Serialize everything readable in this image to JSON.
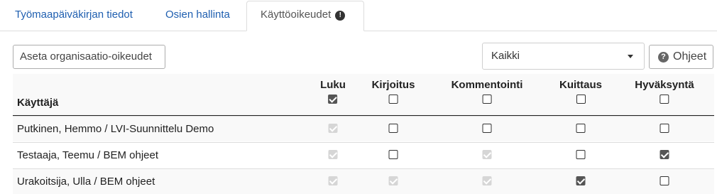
{
  "tabs": [
    {
      "label": "Työmaapäiväkirjan tiedot",
      "active": false
    },
    {
      "label": "Osien hallinta",
      "active": false
    },
    {
      "label": "Käyttöoikeudet",
      "active": true,
      "icon": "exclamation-circle-icon"
    }
  ],
  "toolbar": {
    "org_button_label": "Aseta organisaatio-oikeudet",
    "filter_value": "Kaikki",
    "help_button_label": "Ohjeet",
    "help_icon": "question-circle-icon"
  },
  "table": {
    "user_header": "Käyttäjä",
    "columns": [
      {
        "label": "Luku",
        "header_checked": true
      },
      {
        "label": "Kirjoitus",
        "header_checked": false
      },
      {
        "label": "Kommentointi",
        "header_checked": false
      },
      {
        "label": "Kuittaus",
        "header_checked": false
      },
      {
        "label": "Hyväksyntä",
        "header_checked": false
      }
    ],
    "rows": [
      {
        "name": "Putkinen, Hemmo / LVI-Suunnittelu Demo",
        "cells": [
          {
            "checked": true,
            "disabled": true
          },
          {
            "checked": false,
            "disabled": false
          },
          {
            "checked": false,
            "disabled": false
          },
          {
            "checked": false,
            "disabled": false
          },
          {
            "checked": false,
            "disabled": false
          }
        ]
      },
      {
        "name": "Testaaja, Teemu / BEM ohjeet",
        "cells": [
          {
            "checked": true,
            "disabled": true
          },
          {
            "checked": false,
            "disabled": false
          },
          {
            "checked": true,
            "disabled": true
          },
          {
            "checked": false,
            "disabled": false
          },
          {
            "checked": true,
            "disabled": false
          }
        ]
      },
      {
        "name": "Urakoitsija, Ulla / BEM ohjeet",
        "cells": [
          {
            "checked": true,
            "disabled": true
          },
          {
            "checked": true,
            "disabled": true
          },
          {
            "checked": true,
            "disabled": true
          },
          {
            "checked": true,
            "disabled": false
          },
          {
            "checked": false,
            "disabled": false
          }
        ]
      }
    ]
  }
}
